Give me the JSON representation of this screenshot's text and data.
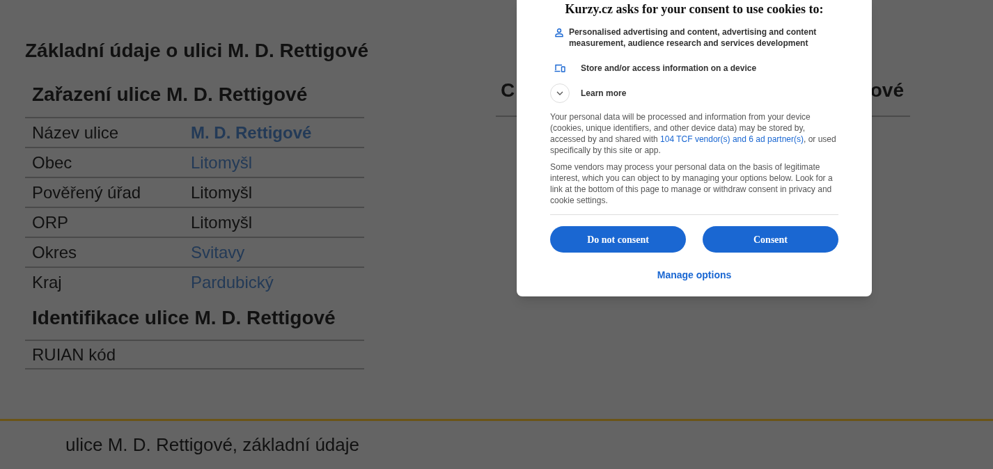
{
  "page_title": "Základní údaje o ulici M. D. Rettigové",
  "sections": [
    {
      "title": "Zařazení ulice M. D. Rettigové",
      "rows": [
        {
          "label": "Název ulice",
          "value": "M. D. Rettigové",
          "kind": "link",
          "bold": true
        },
        {
          "label": "Obec",
          "value": "Litomyšl",
          "kind": "link",
          "bold": false
        },
        {
          "label": "Pověřený úřad",
          "value": "Litomyšl",
          "kind": "text",
          "bold": false
        },
        {
          "label": "ORP",
          "value": "Litomyšl",
          "kind": "text",
          "bold": false
        },
        {
          "label": "Okres",
          "value": "Svitavy",
          "kind": "link",
          "bold": false
        },
        {
          "label": "Kraj",
          "value": "Pardubický",
          "kind": "link",
          "bold": false
        }
      ]
    },
    {
      "title": "Identifikace ulice M. D. Rettigové",
      "rows": [
        {
          "label": "RUIAN kód"
        }
      ]
    }
  ],
  "right_section": {
    "title_start": "C",
    "title_end": "ové"
  },
  "footer": "ulice M. D. Rettigové, základní údaje",
  "consent": {
    "title": "Kurzy.cz asks for your consent to use cookies to:",
    "purposes": [
      {
        "kind": "person",
        "text": "Personalised advertising and content, advertising and content measurement, audience research and services development"
      },
      {
        "kind": "device",
        "text": "Store and/or access information on a device"
      }
    ],
    "learn_more": {
      "label": "Learn more",
      "expanded": false
    },
    "paragraphs": [
      [
        {
          "kind": "text",
          "text": "Your personal data will be processed and information from your device (cookies, unique identifiers, and other device data) may be stored by, accessed by and shared with "
        },
        {
          "kind": "link",
          "text": "104 TCF vendor(s) and 6 ad partner(s)"
        },
        {
          "kind": "text",
          "text": ", or used specifically by this site or app."
        }
      ],
      [
        {
          "kind": "text",
          "text": "Some vendors may process your personal data on the basis of legitimate interest, which you can object to by managing your options below. Look for a link at the bottom of this page to manage or withdraw consent in privacy and cookie settings."
        }
      ]
    ],
    "buttons": [
      "Do not consent",
      "Consent"
    ],
    "manage": "Manage options"
  }
}
